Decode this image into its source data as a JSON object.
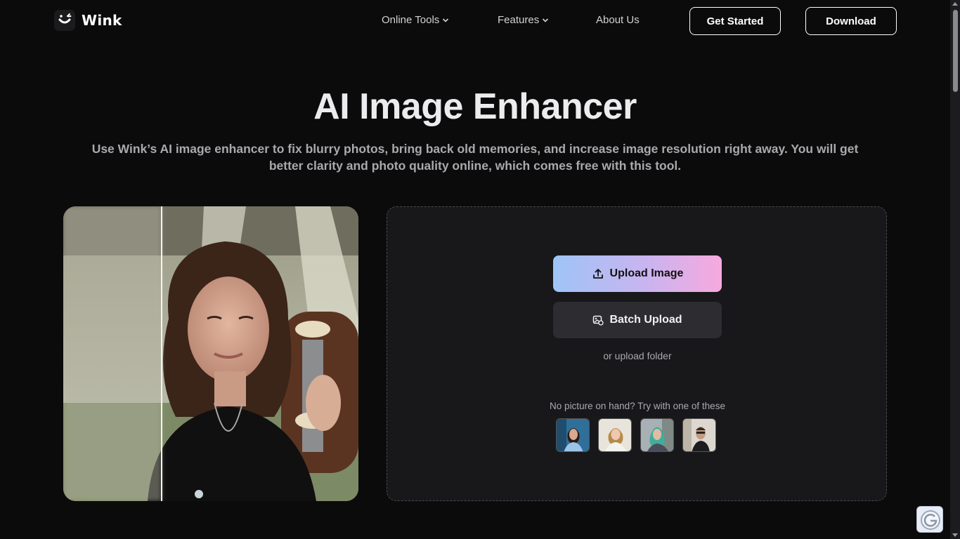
{
  "brand": {
    "name": "Wink"
  },
  "nav": {
    "online_tools": "Online Tools",
    "features": "Features",
    "about": "About Us",
    "get_started": "Get Started",
    "download": "Download"
  },
  "hero": {
    "title": "AI Image Enhancer",
    "subtitle": "Use Wink’s AI image enhancer to fix blurry photos, bring back old memories, and increase image resolution right away. You will get better clarity and photo quality online, which comes free with this tool."
  },
  "upload": {
    "upload_label": "Upload Image",
    "batch_label": "Batch Upload",
    "folder_label": "or upload folder",
    "samples_label": "No picture on hand? Try with one of these"
  },
  "samples": [
    {
      "name": "sample-1"
    },
    {
      "name": "sample-2"
    },
    {
      "name": "sample-3"
    },
    {
      "name": "sample-4"
    }
  ],
  "colors": {
    "background": "#0b0b0c",
    "panel": "#18181b",
    "upload_gradient_start": "#9fc4f6",
    "upload_gradient_end": "#f7a9de",
    "batch_button": "#2c2c31"
  },
  "icons": {
    "upload": "upload-icon",
    "batch": "gallery-icon",
    "chevron": "chevron-down-icon",
    "widget": "g-icon"
  }
}
